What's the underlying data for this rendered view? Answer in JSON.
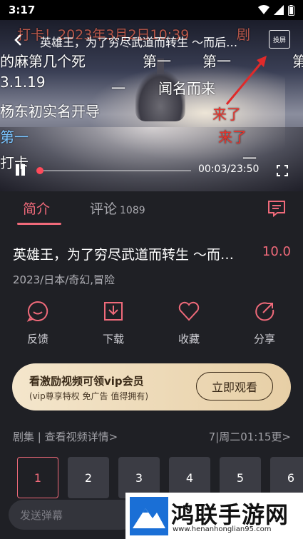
{
  "status_bar": {
    "time": "3:17"
  },
  "player": {
    "title": "英雄王，为了穷尽武道而转生 ～而后…",
    "cast_label": "投屏",
    "time_readout": "00:03/23:50",
    "progress": 0.002,
    "danmaku": [
      {
        "text": "打卡！2023年3月2日10:39",
        "style": "faded"
      },
      {
        "text": "剧",
        "style": "faded"
      },
      {
        "text": "的麻第几个死",
        "style": "white"
      },
      {
        "text": "第一",
        "style": "white"
      },
      {
        "text": "第一",
        "style": "white"
      },
      {
        "text": "第",
        "style": "white"
      },
      {
        "text": "3.1.19",
        "style": "white"
      },
      {
        "text": "一",
        "style": "white"
      },
      {
        "text": "闻名而来",
        "style": "white"
      },
      {
        "text": "杨东初实名开导",
        "style": "white"
      },
      {
        "text": "来了",
        "style": "red"
      },
      {
        "text": "第一",
        "style": "blue"
      },
      {
        "text": "来了",
        "style": "red"
      },
      {
        "text": "打卡",
        "style": "white"
      },
      {
        "text": "一",
        "style": "white"
      }
    ]
  },
  "tabs": {
    "intro": "简介",
    "comments": "评论",
    "comments_count": "1089"
  },
  "show": {
    "title": "英雄王，为了穷尽武道而转生 ～而后…",
    "rating": "10.0",
    "meta": "2023/日本/奇幻,冒险"
  },
  "actions": [
    {
      "label": "反馈",
      "icon": "feedback-icon"
    },
    {
      "label": "下载",
      "icon": "download-icon"
    },
    {
      "label": "收藏",
      "icon": "heart-icon"
    },
    {
      "label": "分享",
      "icon": "share-icon"
    }
  ],
  "vip": {
    "title": "看激励视频可领vip会员",
    "subtitle": "(vip尊享特权 免广告 值得拥有)",
    "button": "立即观看"
  },
  "episodes": {
    "header": "剧集 | 查看视频详情>",
    "update": "7|周二01:15更>",
    "items": [
      "1",
      "2",
      "3",
      "4",
      "5",
      "6"
    ]
  },
  "comment_input": {
    "placeholder": "发送弹幕"
  },
  "watermark": {
    "text": "鸿联手游网",
    "url": "www.henanhonglian95.com"
  },
  "colors": {
    "accent": "#f06a7a",
    "background": "#1f2025",
    "vip_gold": "#e7cfa6"
  }
}
